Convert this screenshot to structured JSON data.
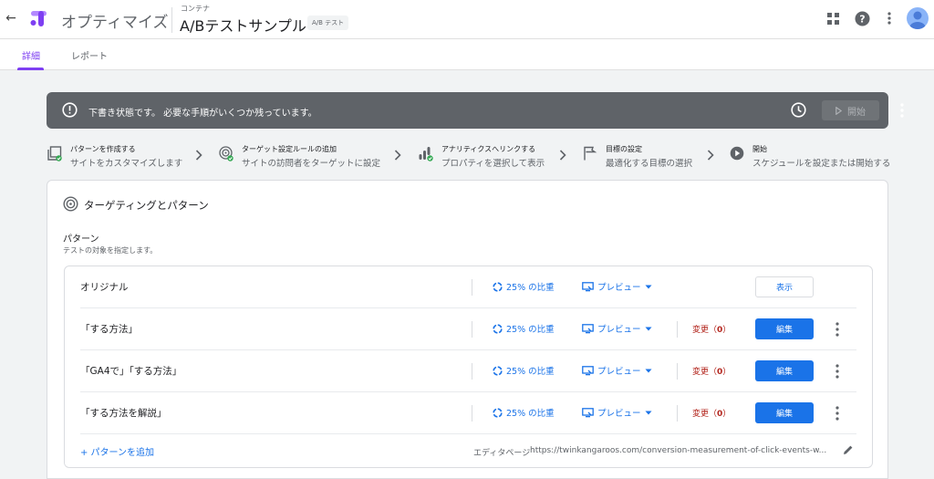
{
  "header": {
    "app_name": "オプティマイズ",
    "container_label": "コンテナ",
    "experience_name": "A/Bテストサンプル",
    "experience_type": "A/B テスト"
  },
  "tabs": [
    {
      "label": "詳細",
      "active": true
    },
    {
      "label": "レポート",
      "active": false
    }
  ],
  "draft_bar": {
    "message": "下書き状態です。 必要な手順がいくつか残っています。",
    "start_label": "開始"
  },
  "steps": [
    {
      "title": "パターンを作成する",
      "description": "サイトをカスタマイズします",
      "icon": "variant-icon",
      "done": true
    },
    {
      "title": "ターゲット設定ルールの追加",
      "description": "サイトの訪問者をターゲットに設定",
      "icon": "target-icon",
      "done": true
    },
    {
      "title": "アナリティクスへリンクする",
      "description": "プロパティを選択して表示",
      "icon": "analytics-icon",
      "done": true
    },
    {
      "title": "目標の設定",
      "description": "最適化する目標の選択",
      "icon": "flag-icon",
      "done": false
    },
    {
      "title": "開始",
      "description": "スケジュールを設定または開始する",
      "icon": "play-icon",
      "done": false
    }
  ],
  "card": {
    "title": "ターゲティングとパターン",
    "section_title": "パターン",
    "section_description": "テストの対象を指定します。",
    "variants": [
      {
        "name": "オリジナル",
        "weight": "25% の比重",
        "preview": "プレビュー",
        "action": "表示",
        "is_original": true
      },
      {
        "name": "「する方法」",
        "weight": "25% の比重",
        "preview": "プレビュー",
        "changes_label": "変更（",
        "changes_count": "0",
        "changes_suffix": "）",
        "action": "編集",
        "is_original": false
      },
      {
        "name": "「GA4で」「する方法」",
        "weight": "25% の比重",
        "preview": "プレビュー",
        "changes_label": "変更（",
        "changes_count": "0",
        "changes_suffix": "）",
        "action": "編集",
        "is_original": false
      },
      {
        "name": "「する方法を解説」",
        "weight": "25% の比重",
        "preview": "プレビュー",
        "changes_label": "変更（",
        "changes_count": "0",
        "changes_suffix": "）",
        "action": "編集",
        "is_original": false
      }
    ],
    "add_variant": "+ パターンを追加",
    "editor_page_label": "エディタページ",
    "editor_page_url": "https://twinkangaroos.com/conversion-measurement-of-click-events-w..."
  },
  "colors": {
    "accent": "#7e3ff2",
    "primary": "#1a73e8",
    "draft_bar": "#5f6368",
    "changes": "#b3261e"
  }
}
